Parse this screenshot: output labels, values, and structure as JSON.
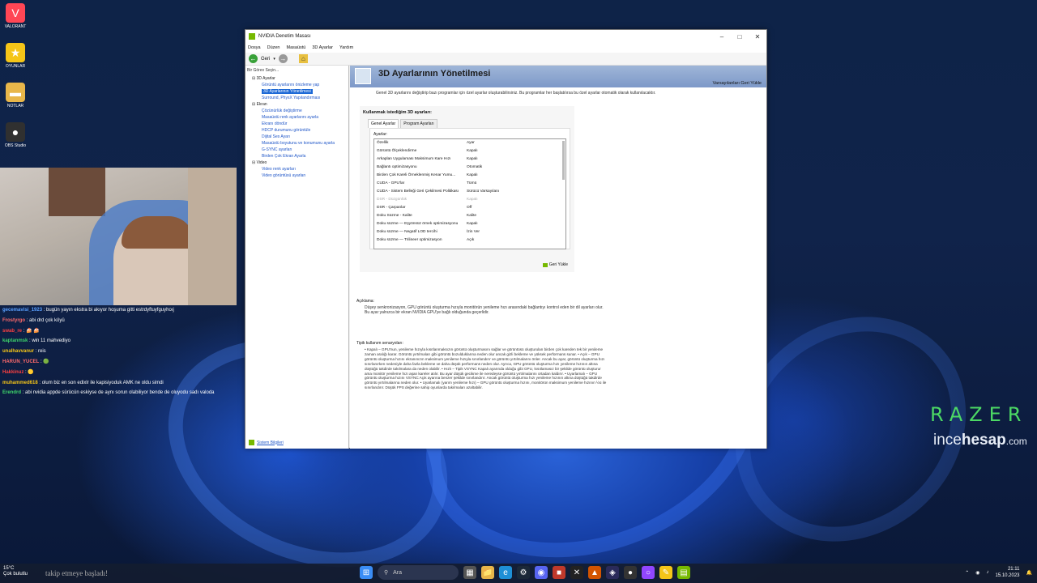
{
  "desktop": {
    "icons": [
      {
        "label": "VALORANT",
        "icon": "valorant-icon",
        "color": "#ff4655"
      },
      {
        "label": "OYUNLAR",
        "icon": "star-icon",
        "color": "#f5c518"
      },
      {
        "label": "NOTLAR",
        "icon": "folder-icon",
        "color": "#e8b64a"
      },
      {
        "label": "OBS Studio",
        "icon": "obs-icon",
        "color": "#303030"
      }
    ]
  },
  "chat": [
    {
      "user": "gecemavisi_1923",
      "color": "#5aa0ff",
      "text": ": bugün yayın ekstra bi akıyor hoşuma gitti estrdyftuyfguyhoıj"
    },
    {
      "user": "Frostyrgo",
      "color": "#ff6b6b",
      "text": ": abi drd çok köyü"
    },
    {
      "user": "swab_re",
      "color": "#ff4040",
      "text": ": 🍰 🍰"
    },
    {
      "user": "kaptanmsk",
      "color": "#3fd46a",
      "text": ": win 11 mahvediyo"
    },
    {
      "user": "unalhavvanur",
      "color": "#f5c518",
      "text": ": reis"
    },
    {
      "user": "HARUN_YUCEL",
      "color": "#ff6b6b",
      "text": ": 🟢"
    },
    {
      "user": "Hakkinuz",
      "color": "#ff4040",
      "text": ": 🟡"
    },
    {
      "user": "muhammed618",
      "color": "#f5c518",
      "text": ": olum biz en son edixlr ile kapisiyoduk AMK ne oldu simdi"
    },
    {
      "user": "Erendrd",
      "color": "#3fd46a",
      "text": ": abi nvidia appde sürücün eskiyse de aynı sorun olabiliyor bende de oluyodu sadı valoda"
    }
  ],
  "watermark": {
    "razer": "RAZER",
    "brand_a": "ince",
    "brand_b": "hesap",
    "brand_c": ".com"
  },
  "window": {
    "title": "NVIDIA Denetim Masası",
    "menu": [
      "Dosya",
      "Düzen",
      "Masaüstü",
      "3D Ayarlar",
      "Yardım"
    ],
    "back_label": "Geri",
    "task_header": "Bir Görev Seçin...",
    "tree": [
      {
        "kind": "cat",
        "label": "3D Ayarlar"
      },
      {
        "kind": "item",
        "label": "Görüntü ayarlarını önizleme yap"
      },
      {
        "kind": "item",
        "label": "3D Ayarlarının Yönetilmesi",
        "selected": true
      },
      {
        "kind": "item",
        "label": "Surround, PhysX Yapılandırması"
      },
      {
        "kind": "cat",
        "label": "Ekran"
      },
      {
        "kind": "item",
        "label": "Çözünürlük değiştirme"
      },
      {
        "kind": "item",
        "label": "Masaüstü renk ayarlarını ayarla"
      },
      {
        "kind": "item",
        "label": "Ekranı döndür"
      },
      {
        "kind": "item",
        "label": "HDCP durumunu görüntüle"
      },
      {
        "kind": "item",
        "label": "Dijital Ses Ayarı"
      },
      {
        "kind": "item",
        "label": "Masaüstü boyutunu ve konumunu ayarla"
      },
      {
        "kind": "item",
        "label": "G-SYNC ayarları"
      },
      {
        "kind": "item",
        "label": "Birden Çok Ekran Ayarla"
      },
      {
        "kind": "cat",
        "label": "Video"
      },
      {
        "kind": "item",
        "label": "Video renk ayarları"
      },
      {
        "kind": "item",
        "label": "Video görüntüsü ayarları"
      }
    ],
    "system_info": "Sistem Bilgileri",
    "page_title": "3D Ayarlarının Yönetilmesi",
    "restore_defaults": "Varsayılanları Geri Yükle",
    "description": "Genel 3D ayarlarını değiştirip bazı programlar için özel ayarlar oluşturabilirsiniz. Bu programlar her başlatılırsa bu özel ayarlar otomatik olarak kullanılacaktır.",
    "settings_title": "Kullanmak istediğim 3D ayarları:",
    "tabs": [
      "Genel Ayarlar",
      "Program Ayarları"
    ],
    "settings_label": "Ayarlar:",
    "grid_header": {
      "feature": "Özellik",
      "setting": "Ayar"
    },
    "grid_rows": [
      {
        "feature": "Görüntü Ölçeklendirme",
        "setting": "Kapalı"
      },
      {
        "feature": "Arkaplan Uygulaması Maksimum Kare Hızı",
        "setting": "Kapalı"
      },
      {
        "feature": "Bağlantı optimizasyonu",
        "setting": "Otomatik"
      },
      {
        "feature": "Birden Çok Kareli Örneklenmiş Kenar Yumu...",
        "setting": "Kapalı"
      },
      {
        "feature": "CUDA - GPU'lar",
        "setting": "Tümü"
      },
      {
        "feature": "CUDA - Sistem Belleği Geri Çekilmesi Politikası",
        "setting": "Sürücü Varsayılanı"
      },
      {
        "feature": "DSR - Düzgünlük",
        "setting": "Kapalı",
        "dim": true
      },
      {
        "feature": "DSR - Çarpanlar",
        "setting": "Off"
      },
      {
        "feature": "Doku Süzme - Kalite",
        "setting": "Kalite"
      },
      {
        "feature": "Doku süzme — Eşyönsüz örnek optimizasyonu",
        "setting": "Kapalı"
      },
      {
        "feature": "Doku süzme — Negatif LOD tercihi",
        "setting": "İzin Ver"
      },
      {
        "feature": "Doku süzme — Trilineer optimizasyon",
        "setting": "Açık"
      }
    ],
    "restore_button": "Geri Yükle",
    "explanation_header": "Açıklama:",
    "explanation": "Düşey senkronizasyon, GPU görüntü oluşturma hızıyla monitörün yenileme hızı arasındaki bağlantıyı kontrol eden bir dil ayarları olur. Bu ayar yalnızca bir ekran NVIDIA GPU'ye bağlı olduğunda geçerlidir.",
    "usage_header": "Tipik kullanım senaryoları:",
    "usage": "• Kapalı – GPU'nun, yenileme hızıyla kısıtlanmaksızın görüntü oluşturmasını sağlar ve görüntüsü oluşturulan birden çok kareden tek bir yenileme zaman aralığı karar. Görüntü yırtılmaları gibi görüntü bozulduklarına neden olur ancak gizli bekleme ve yüksek performans sunar. • Açık – GPU görüntü oluşturma hızını ekranınızın maksimum yenileme hızıyla sınırlandırır ve görüntü yırtılmalarını önler. Ancak bu ayar, görüntü oluşturma hızı sınırlanırken nedeniyle daha fazla bekleme ve daha düşük performans neden olur. Ayrıca, GPU görüntü oluşturma hızı yenileme hızının altına düştüğü takdirde takılmalara da neden olabilir. • Hızlı – Tipik VSYNC Kapalı ayarında olduğu gibi GPU, kısıtlamasız bir şekilde görüntü oluşturur ama monitör yenileme hızı aşan kareler atılır. Bu ayar düşük gecikme ile neredeyse görüntü yırtılmalarını ortadan kaldırır. • Uyarlamalı – GPU görüntü oluşturma hızını VSYNC Açık ayarına benzer şekilde sınırlandırır. Ancak görüntü oluşturma hızı yenileme hızının altına düştüğü takdirde görüntü yırtılmalarına neden olur. • Uyarlamalı (yarım yenileme hızı) – GPU görüntü oluşturma hızını, monitörün maksimum yenileme hızının ½ü ile sınırlandırır. Düşük FPS değerine sahip oyunlarda takılmaları azaltabilir."
  },
  "taskbar": {
    "weather_temp": "15°C",
    "weather_desc": "Çok bulutlu",
    "notice": "takip etmeye başladı!",
    "search_label": "Ara",
    "time": "21:11",
    "date": "15.10.2023"
  }
}
